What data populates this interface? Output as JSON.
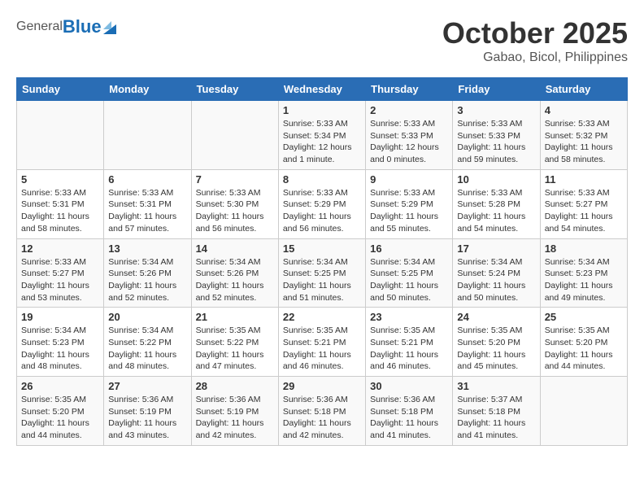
{
  "header": {
    "logo_general": "General",
    "logo_blue": "Blue",
    "title": "October 2025",
    "subtitle": "Gabao, Bicol, Philippines"
  },
  "days_of_week": [
    "Sunday",
    "Monday",
    "Tuesday",
    "Wednesday",
    "Thursday",
    "Friday",
    "Saturday"
  ],
  "weeks": [
    [
      {
        "day": "",
        "info": ""
      },
      {
        "day": "",
        "info": ""
      },
      {
        "day": "",
        "info": ""
      },
      {
        "day": "1",
        "info": "Sunrise: 5:33 AM\nSunset: 5:34 PM\nDaylight: 12 hours\nand 1 minute."
      },
      {
        "day": "2",
        "info": "Sunrise: 5:33 AM\nSunset: 5:33 PM\nDaylight: 12 hours\nand 0 minutes."
      },
      {
        "day": "3",
        "info": "Sunrise: 5:33 AM\nSunset: 5:33 PM\nDaylight: 11 hours\nand 59 minutes."
      },
      {
        "day": "4",
        "info": "Sunrise: 5:33 AM\nSunset: 5:32 PM\nDaylight: 11 hours\nand 58 minutes."
      }
    ],
    [
      {
        "day": "5",
        "info": "Sunrise: 5:33 AM\nSunset: 5:31 PM\nDaylight: 11 hours\nand 58 minutes."
      },
      {
        "day": "6",
        "info": "Sunrise: 5:33 AM\nSunset: 5:31 PM\nDaylight: 11 hours\nand 57 minutes."
      },
      {
        "day": "7",
        "info": "Sunrise: 5:33 AM\nSunset: 5:30 PM\nDaylight: 11 hours\nand 56 minutes."
      },
      {
        "day": "8",
        "info": "Sunrise: 5:33 AM\nSunset: 5:29 PM\nDaylight: 11 hours\nand 56 minutes."
      },
      {
        "day": "9",
        "info": "Sunrise: 5:33 AM\nSunset: 5:29 PM\nDaylight: 11 hours\nand 55 minutes."
      },
      {
        "day": "10",
        "info": "Sunrise: 5:33 AM\nSunset: 5:28 PM\nDaylight: 11 hours\nand 54 minutes."
      },
      {
        "day": "11",
        "info": "Sunrise: 5:33 AM\nSunset: 5:27 PM\nDaylight: 11 hours\nand 54 minutes."
      }
    ],
    [
      {
        "day": "12",
        "info": "Sunrise: 5:33 AM\nSunset: 5:27 PM\nDaylight: 11 hours\nand 53 minutes."
      },
      {
        "day": "13",
        "info": "Sunrise: 5:34 AM\nSunset: 5:26 PM\nDaylight: 11 hours\nand 52 minutes."
      },
      {
        "day": "14",
        "info": "Sunrise: 5:34 AM\nSunset: 5:26 PM\nDaylight: 11 hours\nand 52 minutes."
      },
      {
        "day": "15",
        "info": "Sunrise: 5:34 AM\nSunset: 5:25 PM\nDaylight: 11 hours\nand 51 minutes."
      },
      {
        "day": "16",
        "info": "Sunrise: 5:34 AM\nSunset: 5:25 PM\nDaylight: 11 hours\nand 50 minutes."
      },
      {
        "day": "17",
        "info": "Sunrise: 5:34 AM\nSunset: 5:24 PM\nDaylight: 11 hours\nand 50 minutes."
      },
      {
        "day": "18",
        "info": "Sunrise: 5:34 AM\nSunset: 5:23 PM\nDaylight: 11 hours\nand 49 minutes."
      }
    ],
    [
      {
        "day": "19",
        "info": "Sunrise: 5:34 AM\nSunset: 5:23 PM\nDaylight: 11 hours\nand 48 minutes."
      },
      {
        "day": "20",
        "info": "Sunrise: 5:34 AM\nSunset: 5:22 PM\nDaylight: 11 hours\nand 48 minutes."
      },
      {
        "day": "21",
        "info": "Sunrise: 5:35 AM\nSunset: 5:22 PM\nDaylight: 11 hours\nand 47 minutes."
      },
      {
        "day": "22",
        "info": "Sunrise: 5:35 AM\nSunset: 5:21 PM\nDaylight: 11 hours\nand 46 minutes."
      },
      {
        "day": "23",
        "info": "Sunrise: 5:35 AM\nSunset: 5:21 PM\nDaylight: 11 hours\nand 46 minutes."
      },
      {
        "day": "24",
        "info": "Sunrise: 5:35 AM\nSunset: 5:20 PM\nDaylight: 11 hours\nand 45 minutes."
      },
      {
        "day": "25",
        "info": "Sunrise: 5:35 AM\nSunset: 5:20 PM\nDaylight: 11 hours\nand 44 minutes."
      }
    ],
    [
      {
        "day": "26",
        "info": "Sunrise: 5:35 AM\nSunset: 5:20 PM\nDaylight: 11 hours\nand 44 minutes."
      },
      {
        "day": "27",
        "info": "Sunrise: 5:36 AM\nSunset: 5:19 PM\nDaylight: 11 hours\nand 43 minutes."
      },
      {
        "day": "28",
        "info": "Sunrise: 5:36 AM\nSunset: 5:19 PM\nDaylight: 11 hours\nand 42 minutes."
      },
      {
        "day": "29",
        "info": "Sunrise: 5:36 AM\nSunset: 5:18 PM\nDaylight: 11 hours\nand 42 minutes."
      },
      {
        "day": "30",
        "info": "Sunrise: 5:36 AM\nSunset: 5:18 PM\nDaylight: 11 hours\nand 41 minutes."
      },
      {
        "day": "31",
        "info": "Sunrise: 5:37 AM\nSunset: 5:18 PM\nDaylight: 11 hours\nand 41 minutes."
      },
      {
        "day": "",
        "info": ""
      }
    ]
  ]
}
